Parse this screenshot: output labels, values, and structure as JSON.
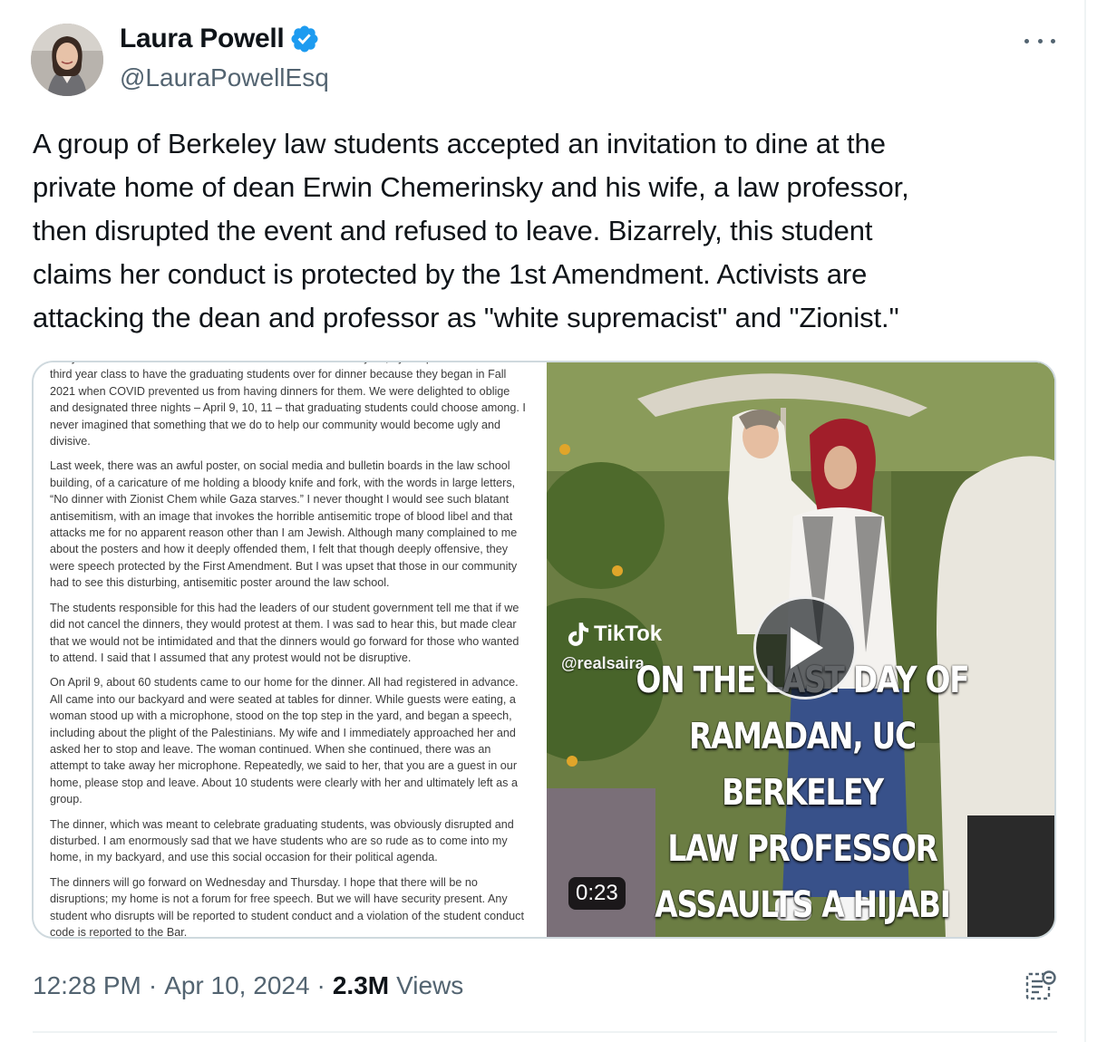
{
  "author": {
    "name": "Laura Powell",
    "handle": "@LauraPowellEsq",
    "verified": true
  },
  "icons": {
    "verified": "verified-badge-icon",
    "more": "more-options-icon",
    "play": "play-icon",
    "analytics": "analytics-icon",
    "tiktok": "tiktok-logo-icon"
  },
  "tweet": {
    "text": "A group of Berkeley law students accepted an invitation to dine at the\nprivate home of dean Erwin Chemerinsky and his wife, a law professor,\nthen disrupted the event and refused to leave. Bizarrely, this student\nclaims her conduct is protected by the 1st Amendment. Activists are\nattacking the dean and professor as \"white supremacist\" and \"Zionist.\""
  },
  "letter": {
    "paragraphs": [
      "first year students to our home for dinner. We were asked this year, by the presidents of the third year class to have the graduating students over for dinner because they began in Fall 2021 when COVID prevented us from having dinners for them.   We were delighted to oblige and designated three nights – April 9, 10, 11 – that graduating students could choose among.  I never imagined that something that we do to help our community would become ugly and divisive.",
      "Last week, there was an awful poster, on social media and bulletin boards in the law school building, of a caricature of me holding a bloody knife and fork, with the words in large letters, “No dinner with Zionist Chem while Gaza starves.”  I never thought I would see such blatant antisemitism, with an image that invokes the horrible antisemitic trope of blood libel and that attacks me for no apparent reason other than I am Jewish.  Although many complained to me about the posters and how it deeply offended them, I felt that though deeply offensive, they were speech protected by the First Amendment.  But I was upset that those in our community had to see this disturbing, antisemitic poster around the law school.",
      "The students responsible for this had the leaders of our student government tell me that if we did not cancel the dinners, they would protest at them.  I was sad to hear this, but made clear that we would not be intimidated and that the dinners would go forward for those who wanted to attend.  I said that I assumed that any protest would not be disruptive.",
      "On April 9, about 60 students came to our home for the dinner.  All had registered in advance.  All came into our backyard and were seated at tables for dinner.  While guests were eating, a woman stood up with a microphone, stood on the top step in the yard, and began a speech, including about the plight of the Palestinians.  My wife and I immediately approached her and asked her to stop and leave.  The woman continued.  When she continued, there was an attempt to take away her microphone.  Repeatedly, we said to her, that you are a guest in our home, please stop and leave.  About 10 students were clearly with her and ultimately left as a group.",
      "The dinner, which was meant to celebrate graduating students, was obviously disrupted and disturbed.  I am enormously sad that we have students who are so rude as to come into my home, in my backyard, and use this social occasion for their political agenda.",
      "The dinners will go forward on Wednesday and Thursday.  I hope that there will be no disruptions; my home is not a forum for free speech.  But we will have security present.  Any student who disrupts will be reported to student conduct and a violation of the student conduct code is reported to the Bar."
    ]
  },
  "video": {
    "tiktok_label": "TikTok",
    "tiktok_handle": "@realsaira",
    "caption_lines": [
      "ON THE LAST DAY OF",
      "RAMADAN, UC BERKELEY",
      "LAW PROFESSOR",
      "ASSAULTS A HIJABI"
    ],
    "duration": "0:23"
  },
  "meta": {
    "time": "12:28 PM",
    "dot": "·",
    "date": "Apr 10, 2024",
    "views_count": "2.3M",
    "views_label": "Views"
  },
  "colors": {
    "text": "#0f1419",
    "secondary": "#536471",
    "verified": "#1d9bf0",
    "border": "#cfd9de"
  }
}
